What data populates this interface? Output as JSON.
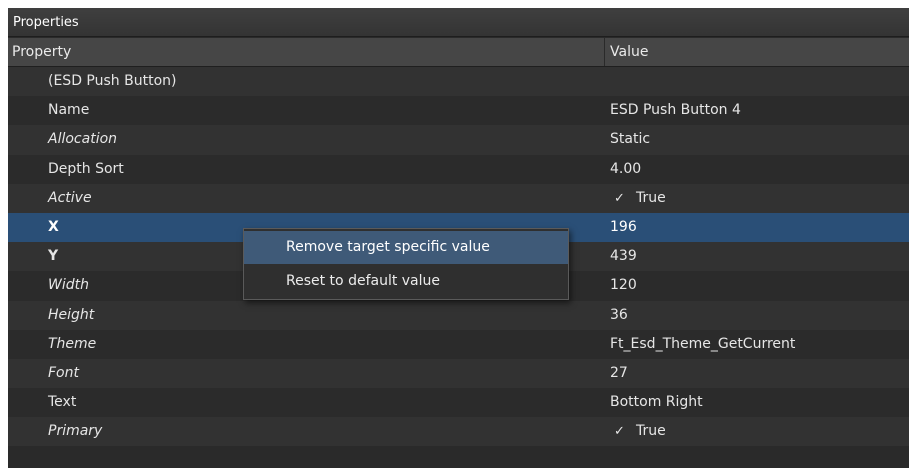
{
  "panel": {
    "title": "Properties",
    "header": {
      "property": "Property",
      "value": "Value"
    },
    "rows": [
      {
        "name": "(ESD Push Button)",
        "value": "",
        "style": "normal"
      },
      {
        "name": "Name",
        "value": "ESD Push Button 4",
        "style": "normal"
      },
      {
        "name": "Allocation",
        "value": "Static",
        "style": "italic"
      },
      {
        "name": "Depth Sort",
        "value": "4.00",
        "style": "normal"
      },
      {
        "name": "Active",
        "value": "True",
        "style": "italic",
        "checked": true
      },
      {
        "name": "X",
        "value": "196",
        "style": "bold",
        "selected": true
      },
      {
        "name": "Y",
        "value": "439",
        "style": "bold"
      },
      {
        "name": "Width",
        "value": "120",
        "style": "italic"
      },
      {
        "name": "Height",
        "value": "36",
        "style": "italic"
      },
      {
        "name": "Theme",
        "value": "Ft_Esd_Theme_GetCurrent",
        "style": "italic"
      },
      {
        "name": "Font",
        "value": "27",
        "style": "italic"
      },
      {
        "name": "Text",
        "value": "Bottom Right",
        "style": "normal"
      },
      {
        "name": "Primary",
        "value": "True",
        "style": "italic",
        "checked": true
      }
    ],
    "check_glyph": "✓"
  },
  "context_menu": {
    "items": [
      {
        "label": "Remove target specific value",
        "highlighted": true
      },
      {
        "label": "Reset to default value",
        "highlighted": false
      }
    ]
  },
  "colors": {
    "panel_bg": "#2a2a2a",
    "header_bg": "#464646",
    "selected_row": "#2a4f77",
    "menu_highlight": "#3f5a78"
  }
}
